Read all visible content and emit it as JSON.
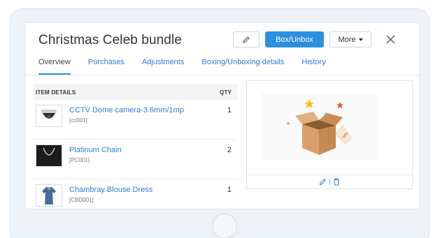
{
  "header": {
    "title": "Christmas Celeb bundle",
    "box_unbox_label": "Box/Unbox",
    "more_label": "More"
  },
  "tabs": [
    {
      "label": "Overview",
      "active": true
    },
    {
      "label": "Purchases",
      "active": false
    },
    {
      "label": "Adjustments",
      "active": false
    },
    {
      "label": "Boxing/Unboxing details",
      "active": false
    },
    {
      "label": "History",
      "active": false
    }
  ],
  "table": {
    "col_item": "ITEM DETAILS",
    "col_qty": "QTY",
    "rows": [
      {
        "name": "CCTV Dome camera-3.6mm/1mp",
        "sku": "[cc001]",
        "qty": "1",
        "thumb": "camera-icon"
      },
      {
        "name": "Platinum Chain",
        "sku": "[PC001]",
        "qty": "2",
        "thumb": "chain-icon"
      },
      {
        "name": "Chambray Blouse Dress",
        "sku": "[CBD001]",
        "qty": "1",
        "thumb": "dress-icon"
      }
    ]
  },
  "image_panel": {
    "image": "gift-box-illustration",
    "tag_text": "Gifts"
  },
  "colors": {
    "primary": "#2d8fe0",
    "link": "#2d7ed6",
    "box": "#d9a06a"
  }
}
